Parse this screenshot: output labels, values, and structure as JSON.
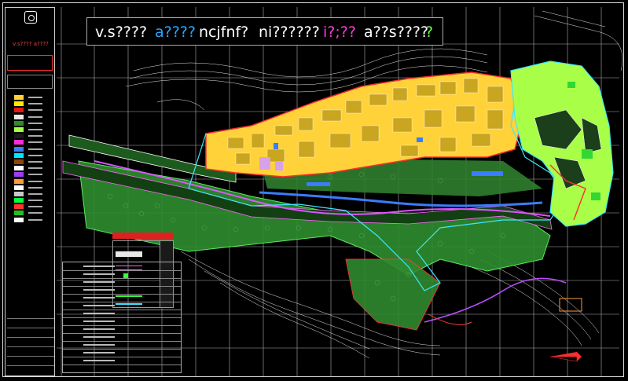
{
  "title_block": {
    "org_lines": [
      "",
      ""
    ],
    "red_caption": "v.s???? a????",
    "box_caption": "",
    "legend_items": [
      {
        "color": "#ffd23a"
      },
      {
        "color": "#ffea00"
      },
      {
        "color": "#e11919"
      },
      {
        "color": "#e8e8e8"
      },
      {
        "color": "#2e8b2e"
      },
      {
        "color": "#a9ff48"
      },
      {
        "color": "#1a1a1a"
      },
      {
        "color": "#ff2bd6"
      },
      {
        "color": "#3a7dff"
      },
      {
        "color": "#00e5ff"
      },
      {
        "color": "#8b4513"
      },
      {
        "color": "#ffffff"
      },
      {
        "color": "#9c3df0"
      },
      {
        "color": "#ff9a3c"
      },
      {
        "color": "#ffffff"
      },
      {
        "color": "#c8c8c8"
      },
      {
        "color": "#00ff3b"
      },
      {
        "color": "#ff3333"
      },
      {
        "color": "#20c020"
      },
      {
        "color": "#ffffff"
      }
    ]
  },
  "map_title": {
    "parts": [
      {
        "text": "v.s????",
        "color": "#ffffff"
      },
      {
        "text": "a????",
        "color": "#2aa8ff"
      },
      {
        "text": "ncjfnf?",
        "color": "#ffffff"
      },
      {
        "text": "ni??????",
        "color": "#ffffff"
      },
      {
        "text": "i?;??",
        "color": "#ff3bd6"
      },
      {
        "text": "a??s????",
        "color": "#ffffff"
      },
      {
        "text": "?",
        "color": "#66ff44"
      }
    ]
  },
  "colors": {
    "residential": "#ffd23a",
    "forest": "#2e8b2e",
    "park": "#a9ff48",
    "water": "#3a7dff",
    "boundary_cyan": "#3ee6ff",
    "boundary_red": "#e11919",
    "contour": "#ffffff"
  },
  "icons": {
    "logo": "municipality-logo-icon",
    "north_arrow": "north-arrow-icon"
  }
}
